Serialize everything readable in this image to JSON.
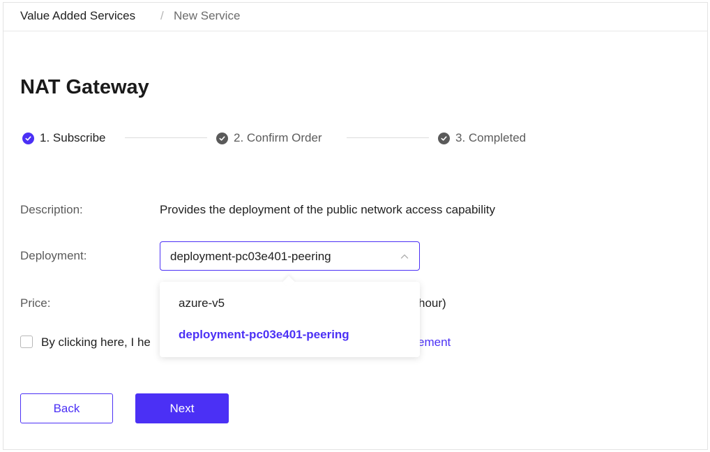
{
  "breadcrumb": {
    "items": [
      "Value Added Services",
      "New Service"
    ],
    "separator": "/"
  },
  "page_title": "NAT Gateway",
  "steps": [
    {
      "label": "1. Subscribe",
      "state": "active"
    },
    {
      "label": "2. Confirm Order",
      "state": "completed"
    },
    {
      "label": "3. Completed",
      "state": "completed"
    }
  ],
  "form": {
    "description_label": "Description:",
    "description_value": "Provides the deployment of the public network access capability",
    "deployment_label": "Deployment:",
    "deployment_value": "deployment-pc03e401-peering",
    "price_label": "Price:",
    "price_value_visible_suffix": "hour)",
    "agreement_text_visible": "By clicking here, I he",
    "agreement_link_visible": "ement"
  },
  "dropdown": {
    "open": true,
    "options": [
      "azure-v5",
      "deployment-pc03e401-peering"
    ],
    "selected_index": 1
  },
  "buttons": {
    "back": "Back",
    "next": "Next"
  },
  "colors": {
    "accent": "#4b30f5",
    "completed_icon": "#5a5a5a",
    "label_gray": "#5a5a5a"
  },
  "icons": {
    "step_icon": "check-circle-icon",
    "select_chevron": "chevron-up-icon"
  }
}
